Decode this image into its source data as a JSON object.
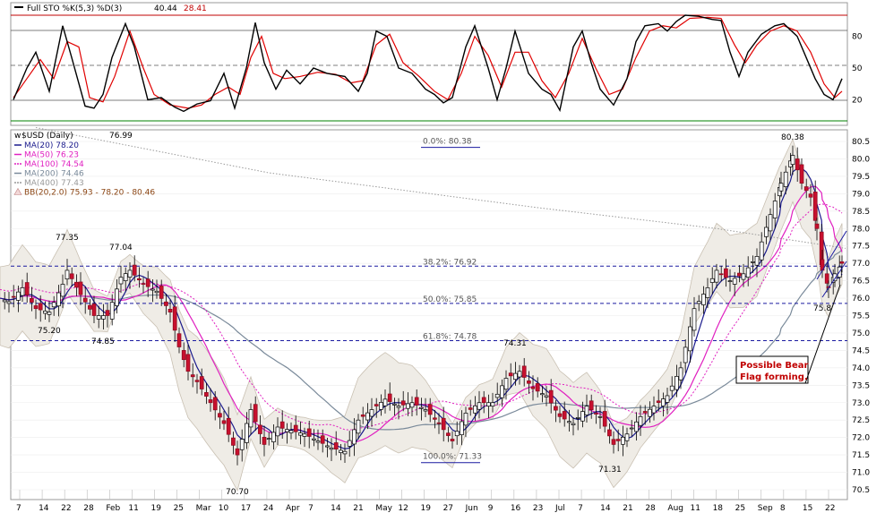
{
  "sto_panel": {
    "label": "Full STO %K(5,3) %D(3)",
    "k_value": "40.44",
    "d_value": "28.41",
    "levels": [
      80,
      50,
      20
    ]
  },
  "price_panel": {
    "label": "$USD (Daily)",
    "last": "76.99",
    "legend": [
      {
        "text": "MA(20) 78.20",
        "color": "#1a1a8c"
      },
      {
        "text": "MA(50) 76.23",
        "color": "#e020c0"
      },
      {
        "text": "MA(100) 74.54",
        "color": "#e020c0"
      },
      {
        "text": "MA(200) 74.46",
        "color": "#7a8a9a"
      },
      {
        "text": "MA(400) 77.43",
        "color": "#9a9a9a"
      },
      {
        "text": "BB(20,2.0) 75.93 - 78.20 - 80.46",
        "color": "#8b4513"
      }
    ],
    "y_ticks": [
      "80.5",
      "80.0",
      "79.5",
      "79.0",
      "78.5",
      "78.0",
      "77.5",
      "77.0",
      "76.5",
      "76.0",
      "75.5",
      "75.0",
      "74.5",
      "74.0",
      "73.5",
      "73.0",
      "72.5",
      "72.0",
      "71.5",
      "71.0",
      "70.5"
    ],
    "fib_levels": [
      {
        "label": "0.0%: 80.38",
        "value": 80.38
      },
      {
        "label": "38.2%: 76.92",
        "value": 76.92
      },
      {
        "label": "50.0%: 75.85",
        "value": 75.85
      },
      {
        "label": "61.8%: 74.78",
        "value": 74.78
      },
      {
        "label": "100.0%: 71.33",
        "value": 71.33
      }
    ],
    "annotations": [
      "77.35",
      "77.04",
      "75.20",
      "74.85",
      "70.70",
      "74.31",
      "71.31",
      "80.38",
      "75.8"
    ],
    "note": [
      "Possible Bear",
      "Flag forming."
    ]
  },
  "x_axis": [
    "7",
    "14",
    "22",
    "28",
    "Feb",
    "11",
    "19",
    "25",
    "Mar",
    "10",
    "17",
    "24",
    "Apr",
    "7",
    "14",
    "21",
    "May",
    "12",
    "19",
    "27",
    "Jun",
    "9",
    "16",
    "23",
    "Jul",
    "7",
    "14",
    "21",
    "28",
    "Aug",
    "11",
    "18",
    "25",
    "Sep",
    "8",
    "15",
    "22"
  ],
  "chart_data": {
    "type": "candlestick",
    "title": "$USD (Daily)",
    "ylim": [
      70.5,
      80.5
    ],
    "price_path": [
      [
        0,
        76.0
      ],
      [
        10,
        75.9
      ],
      [
        25,
        76.3
      ],
      [
        40,
        75.7
      ],
      [
        55,
        75.6
      ],
      [
        70,
        76.4
      ],
      [
        75,
        76.8
      ],
      [
        90,
        76.1
      ],
      [
        105,
        75.5
      ],
      [
        120,
        75.5
      ],
      [
        135,
        76.6
      ],
      [
        145,
        76.8
      ],
      [
        160,
        76.4
      ],
      [
        175,
        76.2
      ],
      [
        190,
        75.6
      ],
      [
        200,
        74.6
      ],
      [
        210,
        73.9
      ],
      [
        220,
        73.6
      ],
      [
        235,
        73.0
      ],
      [
        250,
        72.4
      ],
      [
        265,
        71.5
      ],
      [
        280,
        72.8
      ],
      [
        295,
        71.8
      ],
      [
        310,
        72.3
      ],
      [
        325,
        72.2
      ],
      [
        340,
        72.1
      ],
      [
        355,
        71.9
      ],
      [
        370,
        71.7
      ],
      [
        385,
        71.6
      ],
      [
        400,
        72.5
      ],
      [
        415,
        72.8
      ],
      [
        430,
        73.1
      ],
      [
        445,
        72.9
      ],
      [
        460,
        73.0
      ],
      [
        475,
        72.8
      ],
      [
        490,
        72.4
      ],
      [
        505,
        71.9
      ],
      [
        520,
        72.7
      ],
      [
        535,
        73.0
      ],
      [
        550,
        73.0
      ],
      [
        565,
        73.7
      ],
      [
        580,
        73.9
      ],
      [
        595,
        73.4
      ],
      [
        610,
        73.2
      ],
      [
        625,
        72.6
      ],
      [
        640,
        72.4
      ],
      [
        655,
        72.9
      ],
      [
        670,
        72.6
      ],
      [
        685,
        71.8
      ],
      [
        700,
        72.1
      ],
      [
        715,
        72.6
      ],
      [
        730,
        72.9
      ],
      [
        745,
        73.2
      ],
      [
        760,
        74.0
      ],
      [
        775,
        75.7
      ],
      [
        790,
        76.3
      ],
      [
        800,
        76.8
      ],
      [
        815,
        76.5
      ],
      [
        830,
        76.7
      ],
      [
        845,
        77.2
      ],
      [
        860,
        78.4
      ],
      [
        872,
        79.3
      ],
      [
        885,
        80.1
      ],
      [
        895,
        79.3
      ],
      [
        905,
        78.9
      ],
      [
        912,
        78.0
      ],
      [
        918,
        76.8
      ],
      [
        925,
        76.3
      ],
      [
        932,
        76.7
      ],
      [
        940,
        77.0
      ]
    ],
    "stochastic_k_path": [
      [
        15,
        20
      ],
      [
        30,
        50
      ],
      [
        40,
        65
      ],
      [
        55,
        28
      ],
      [
        70,
        90
      ],
      [
        80,
        60
      ],
      [
        95,
        14
      ],
      [
        105,
        12
      ],
      [
        115,
        25
      ],
      [
        125,
        60
      ],
      [
        140,
        92
      ],
      [
        150,
        70
      ],
      [
        165,
        20
      ],
      [
        180,
        22
      ],
      [
        195,
        13
      ],
      [
        205,
        9
      ],
      [
        220,
        16
      ],
      [
        235,
        19
      ],
      [
        250,
        45
      ],
      [
        262,
        12
      ],
      [
        275,
        50
      ],
      [
        285,
        93
      ],
      [
        295,
        55
      ],
      [
        308,
        30
      ],
      [
        320,
        48
      ],
      [
        335,
        35
      ],
      [
        350,
        50
      ],
      [
        365,
        45
      ],
      [
        385,
        42
      ],
      [
        400,
        28
      ],
      [
        410,
        45
      ],
      [
        420,
        85
      ],
      [
        432,
        80
      ],
      [
        445,
        50
      ],
      [
        460,
        45
      ],
      [
        475,
        30
      ],
      [
        485,
        25
      ],
      [
        495,
        17
      ],
      [
        505,
        22
      ],
      [
        520,
        70
      ],
      [
        530,
        90
      ],
      [
        545,
        50
      ],
      [
        555,
        20
      ],
      [
        565,
        50
      ],
      [
        575,
        85
      ],
      [
        590,
        45
      ],
      [
        605,
        30
      ],
      [
        615,
        25
      ],
      [
        625,
        10
      ],
      [
        640,
        70
      ],
      [
        650,
        85
      ],
      [
        660,
        55
      ],
      [
        670,
        30
      ],
      [
        685,
        15
      ],
      [
        700,
        40
      ],
      [
        710,
        75
      ],
      [
        720,
        90
      ],
      [
        735,
        92
      ],
      [
        745,
        85
      ],
      [
        755,
        94
      ],
      [
        765,
        100
      ],
      [
        780,
        99
      ],
      [
        795,
        96
      ],
      [
        805,
        95
      ],
      [
        815,
        65
      ],
      [
        825,
        42
      ],
      [
        835,
        65
      ],
      [
        850,
        82
      ],
      [
        865,
        90
      ],
      [
        875,
        92
      ],
      [
        890,
        80
      ],
      [
        900,
        60
      ],
      [
        910,
        40
      ],
      [
        920,
        25
      ],
      [
        930,
        20
      ],
      [
        940,
        40
      ]
    ],
    "stochastic_d_path": [
      [
        15,
        22
      ],
      [
        30,
        40
      ],
      [
        45,
        58
      ],
      [
        60,
        40
      ],
      [
        75,
        75
      ],
      [
        88,
        70
      ],
      [
        100,
        22
      ],
      [
        115,
        18
      ],
      [
        128,
        42
      ],
      [
        145,
        85
      ],
      [
        160,
        50
      ],
      [
        172,
        25
      ],
      [
        190,
        15
      ],
      [
        210,
        12
      ],
      [
        225,
        15
      ],
      [
        240,
        25
      ],
      [
        255,
        32
      ],
      [
        268,
        25
      ],
      [
        280,
        60
      ],
      [
        292,
        80
      ],
      [
        305,
        45
      ],
      [
        318,
        40
      ],
      [
        335,
        42
      ],
      [
        355,
        46
      ],
      [
        375,
        44
      ],
      [
        392,
        36
      ],
      [
        405,
        38
      ],
      [
        420,
        72
      ],
      [
        435,
        82
      ],
      [
        450,
        55
      ],
      [
        468,
        42
      ],
      [
        485,
        28
      ],
      [
        500,
        20
      ],
      [
        515,
        45
      ],
      [
        530,
        80
      ],
      [
        545,
        62
      ],
      [
        560,
        32
      ],
      [
        575,
        65
      ],
      [
        590,
        65
      ],
      [
        605,
        38
      ],
      [
        620,
        22
      ],
      [
        635,
        45
      ],
      [
        650,
        78
      ],
      [
        665,
        50
      ],
      [
        680,
        25
      ],
      [
        695,
        30
      ],
      [
        710,
        60
      ],
      [
        725,
        85
      ],
      [
        740,
        90
      ],
      [
        755,
        88
      ],
      [
        770,
        97
      ],
      [
        790,
        98
      ],
      [
        805,
        97
      ],
      [
        820,
        72
      ],
      [
        832,
        55
      ],
      [
        845,
        72
      ],
      [
        860,
        85
      ],
      [
        875,
        90
      ],
      [
        890,
        85
      ],
      [
        905,
        65
      ],
      [
        920,
        35
      ],
      [
        932,
        22
      ],
      [
        940,
        28
      ]
    ]
  }
}
